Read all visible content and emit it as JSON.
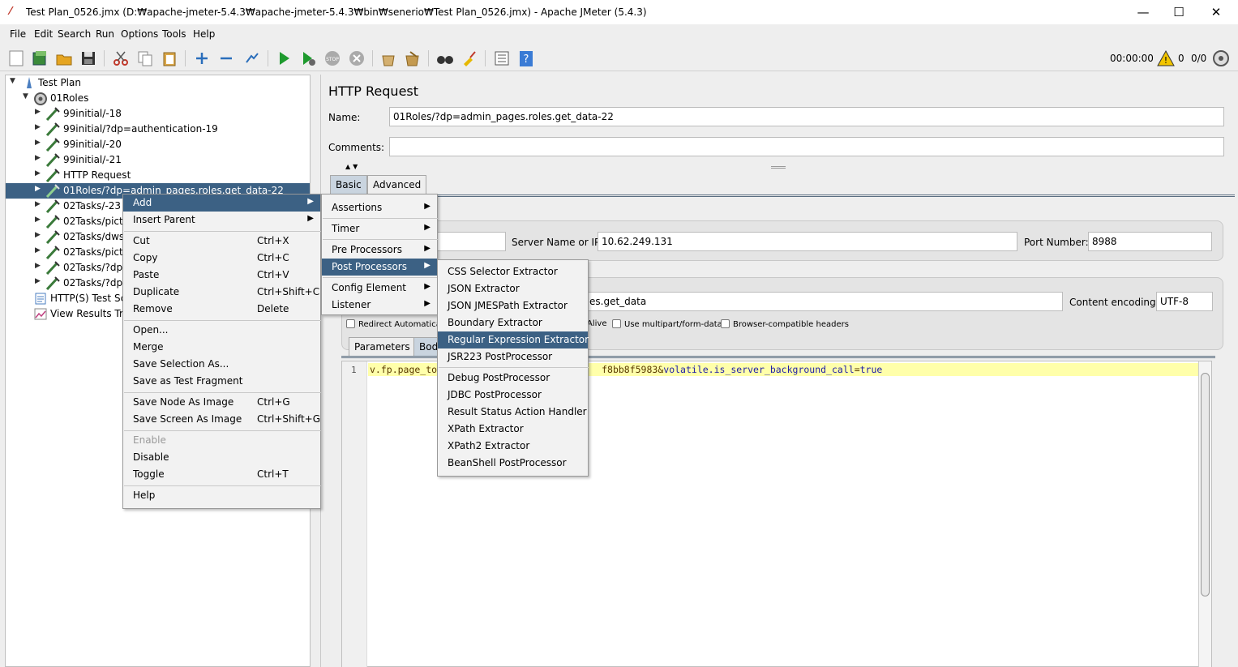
{
  "window": {
    "title": "Test Plan_0526.jmx (D:₩apache-jmeter-5.4.3₩apache-jmeter-5.4.3₩bin₩senerio₩Test Plan_0526.jmx) - Apache JMeter (5.4.3)",
    "minimize": "—",
    "maximize": "☐",
    "close": "✕"
  },
  "menubar": [
    "File",
    "Edit",
    "Search",
    "Run",
    "Options",
    "Tools",
    "Help"
  ],
  "toolbar": {
    "timer": "00:00:00",
    "warning_count": "0",
    "thread_count": "0/0"
  },
  "tree": [
    {
      "label": "Test Plan",
      "icon": "test-plan-icon",
      "expanded": true
    },
    {
      "label": "01Roles",
      "icon": "thread-group-gear-icon",
      "expanded": true
    },
    {
      "label": "99initial/-18",
      "icon": "sampler-pipette-icon"
    },
    {
      "label": "99initial/?dp=authentication-19",
      "icon": "sampler-pipette-icon"
    },
    {
      "label": "99initial/-20",
      "icon": "sampler-pipette-icon"
    },
    {
      "label": "99initial/-21",
      "icon": "sampler-pipette-icon"
    },
    {
      "label": "HTTP Request",
      "icon": "sampler-pipette-icon"
    },
    {
      "label": "01Roles/?dp=admin_pages.roles.get_data-22",
      "icon": "sampler-pipette-icon",
      "selected": true
    },
    {
      "label": "02Tasks/-23",
      "icon": "sampler-pipette-icon"
    },
    {
      "label": "02Tasks/picts",
      "icon": "sampler-pipette-icon"
    },
    {
      "label": "02Tasks/dws",
      "icon": "sampler-pipette-icon"
    },
    {
      "label": "02Tasks/picts",
      "icon": "sampler-pipette-icon"
    },
    {
      "label": "02Tasks/?dp",
      "icon": "sampler-pipette-icon"
    },
    {
      "label": "02Tasks/?dp",
      "icon": "sampler-pipette-icon"
    },
    {
      "label": "HTTP(S) Test Sc",
      "icon": "recorder-icon"
    },
    {
      "label": "View Results Tre",
      "icon": "results-tree-icon"
    }
  ],
  "panel": {
    "title": "HTTP Request",
    "name_label": "Name:",
    "name_value": "01Roles/?dp=admin_pages.roles.get_data-22",
    "comments_label": "Comments:",
    "comments_value": "",
    "tabs": [
      "Basic",
      "Advanced"
    ],
    "server_label": "Server Name or IP:",
    "server_value": "10.62.249.131",
    "port_label": "Port Number:",
    "port_value": "8988",
    "path_value": "es.get_data",
    "encoding_label": "Content encoding:",
    "encoding_value": "UTF-8",
    "checkboxes": [
      "Redirect Automatica",
      "Alive",
      "Use multipart/form-data",
      "Browser-compatible headers"
    ],
    "body_tabs": [
      "Parameters",
      "Bod"
    ],
    "body": {
      "line_number": "1",
      "code_start": "v.fp.page_to",
      "code_hash": "f8bb8f5983",
      "code_amp": "&",
      "code_key": "volatile.is_server_background_call",
      "code_eq": "=",
      "code_val": "true"
    }
  },
  "context_menu": {
    "items": [
      {
        "label": "Add",
        "submenu": true,
        "highlighted": true
      },
      {
        "label": "Insert Parent",
        "submenu": true
      },
      {
        "label": "Cut",
        "accel": "Ctrl+X"
      },
      {
        "label": "Copy",
        "accel": "Ctrl+C"
      },
      {
        "label": "Paste",
        "accel": "Ctrl+V"
      },
      {
        "label": "Duplicate",
        "accel": "Ctrl+Shift+C"
      },
      {
        "label": "Remove",
        "accel": "Delete"
      },
      {
        "label": "Open..."
      },
      {
        "label": "Merge"
      },
      {
        "label": "Save Selection As..."
      },
      {
        "label": "Save as Test Fragment"
      },
      {
        "label": "Save Node As Image",
        "accel": "Ctrl+G"
      },
      {
        "label": "Save Screen As Image",
        "accel": "Ctrl+Shift+G"
      },
      {
        "label": "Enable",
        "disabled": true
      },
      {
        "label": "Disable"
      },
      {
        "label": "Toggle",
        "accel": "Ctrl+T"
      },
      {
        "label": "Help"
      }
    ]
  },
  "add_submenu": {
    "items": [
      {
        "label": "Assertions"
      },
      {
        "label": "Timer"
      },
      {
        "label": "Pre Processors"
      },
      {
        "label": "Post Processors",
        "highlighted": true
      },
      {
        "label": "Config Element"
      },
      {
        "label": "Listener"
      }
    ]
  },
  "post_processors_submenu": {
    "items": [
      {
        "label": "CSS Selector Extractor"
      },
      {
        "label": "JSON Extractor"
      },
      {
        "label": "JSON JMESPath Extractor"
      },
      {
        "label": "Boundary Extractor"
      },
      {
        "label": "Regular Expression Extractor",
        "highlighted": true
      },
      {
        "label": "JSR223 PostProcessor"
      },
      {
        "label": "Debug PostProcessor"
      },
      {
        "label": "JDBC PostProcessor"
      },
      {
        "label": "Result Status Action Handler"
      },
      {
        "label": "XPath Extractor"
      },
      {
        "label": "XPath2 Extractor"
      },
      {
        "label": "BeanShell PostProcessor"
      }
    ]
  },
  "colors": {
    "selection": "#3c6184",
    "code_highlight": "#ffffaa",
    "tab_active": "#c9d4df"
  }
}
